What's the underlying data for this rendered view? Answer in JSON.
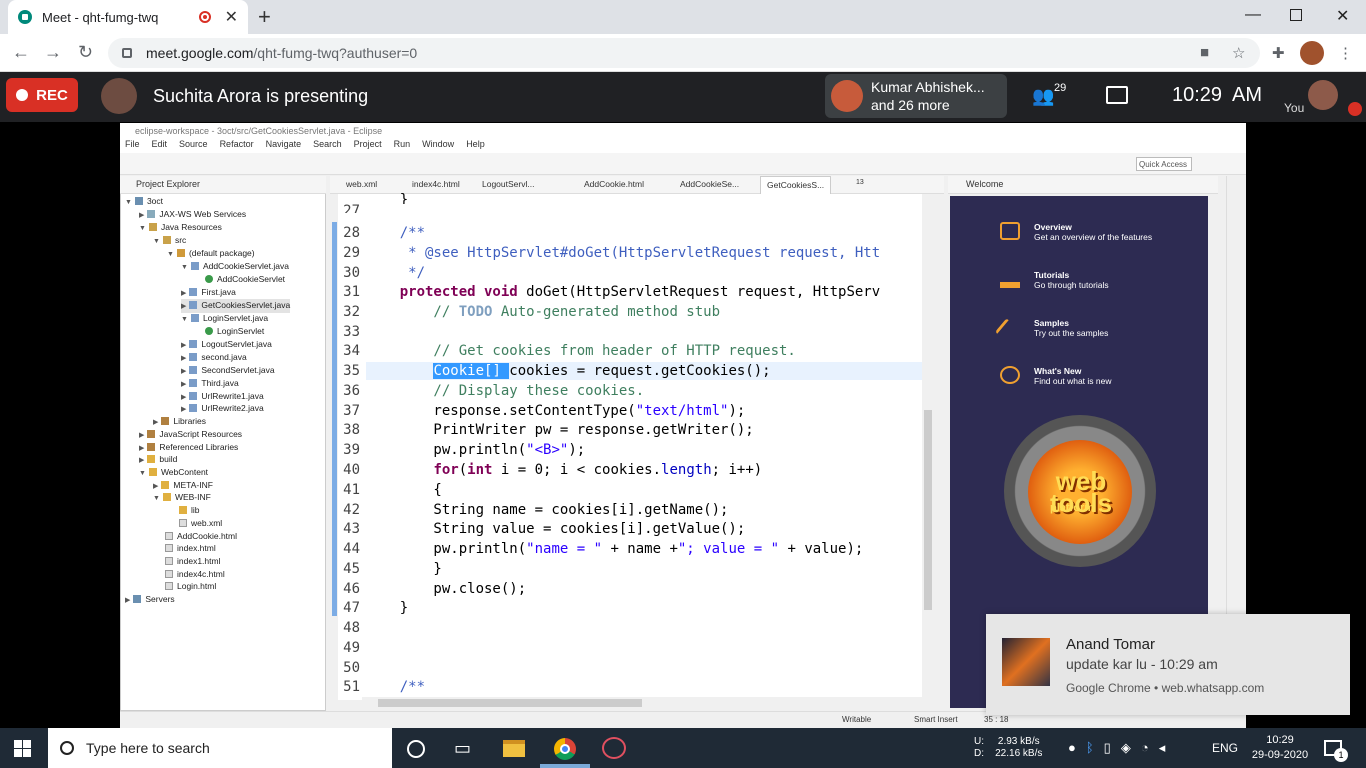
{
  "browser": {
    "tab_title": "Meet - qht-fumg-twq",
    "url_host": "meet.google.com",
    "url_path": "/qht-fumg-twq?authuser=0"
  },
  "meet": {
    "rec_label": "REC",
    "presenter_text": "Suchita Arora is presenting",
    "participant_name": "Kumar Abhishek...",
    "participant_more": "and 26 more",
    "people_count": "29",
    "time": "10:29  AM",
    "you_label": "You"
  },
  "eclipse": {
    "title": "eclipse-workspace - 3oct/src/GetCookiesServlet.java - Eclipse",
    "menu": [
      "File",
      "Edit",
      "Source",
      "Refactor",
      "Navigate",
      "Search",
      "Project",
      "Run",
      "Window",
      "Help"
    ],
    "quick_access": "Quick Access",
    "project_explorer_title": "Project Explorer",
    "tree": [
      "3oct",
      "JAX-WS Web Services",
      "Java Resources",
      "src",
      "(default package)",
      "AddCookieServlet.java",
      "AddCookieServlet",
      "First.java",
      "GetCookiesServlet.java",
      "LoginServlet.java",
      "LoginServlet",
      "LogoutServlet.java",
      "second.java",
      "SecondServlet.java",
      "Third.java",
      "UrlRewrite1.java",
      "UrlRewrite2.java",
      "Libraries",
      "JavaScript Resources",
      "Referenced Libraries",
      "build",
      "WebContent",
      "META-INF",
      "WEB-INF",
      "lib",
      "web.xml",
      "AddCookie.html",
      "index.html",
      "index1.html",
      "index4c.html",
      "Login.html",
      "Servers"
    ],
    "editor_tabs": [
      "web.xml",
      "index4c.html",
      "LogoutServl...",
      "AddCookie.html",
      "AddCookieSe...",
      "GetCookiesS...",
      "13"
    ],
    "line_numbers": [
      "27",
      "28",
      "29",
      "30",
      "31",
      "32",
      "33",
      "34",
      "35",
      "36",
      "37",
      "38",
      "39",
      "40",
      "41",
      "42",
      "43",
      "44",
      "45",
      "46",
      "47",
      "48",
      "49",
      "50",
      "51"
    ],
    "code": {
      "l27": "    }",
      "l28": "    /**",
      "l29_a": "     * @see ",
      "l29_b": "HttpServlet#doGet(HttpServletRequest request, Htt",
      "l30": "     */",
      "l31_kw": "    protected void ",
      "l31_rest": "doGet(HttpServletRequest request, HttpServ",
      "l32_a": "        // ",
      "l32_b": "TODO",
      "l32_c": " Auto-generated method stub",
      "l34": "        // Get cookies from header of HTTP request.",
      "l35_a": "Cookie[] ",
      "l35_b": "cookies = request.getCookies();",
      "l36": "        // Display these cookies.",
      "l37_a": "        response.setContentType(",
      "l37_b": "\"text/html\"",
      "l37_c": ");",
      "l38": "        PrintWriter pw = response.getWriter();",
      "l39_a": "        pw.println(",
      "l39_b": "\"<B>\"",
      "l39_c": ");",
      "l40_kw1": "for",
      "l40_b": "(",
      "l40_kw2": "int",
      "l40_c": " i = 0; i < cookies.",
      "l40_fd": "length",
      "l40_d": "; i++)",
      "l41": "        {",
      "l42": "        String name = cookies[i].getName();",
      "l43": "        String value = cookies[i].getValue();",
      "l44_a": "        pw.println(",
      "l44_b": "\"name = \"",
      "l44_c": " + name +",
      "l44_d": "\"; value = \"",
      "l44_e": " + value);",
      "l45": "        }",
      "l46": "        pw.close();",
      "l47": "    }",
      "l51": "    /**"
    },
    "welcome_title": "Welcome",
    "welcome_items": [
      {
        "title": "Overview",
        "desc": "Get an overview of the features"
      },
      {
        "title": "Tutorials",
        "desc": "Go through tutorials"
      },
      {
        "title": "Samples",
        "desc": "Try out the samples"
      },
      {
        "title": "What's New",
        "desc": "Find out what is new"
      }
    ],
    "logo_word": "web tools",
    "logo_sub": "platform",
    "status": {
      "writable": "Writable",
      "insert": "Smart Insert",
      "position": "35 : 18"
    }
  },
  "notification": {
    "sender": "Anand Tomar",
    "message": "update kar lu - 10:29 am",
    "source": "Google Chrome • web.whatsapp.com"
  },
  "taskbar": {
    "search_placeholder": "Type here to search",
    "upload": "2.93 kB/s",
    "download": "22.16 kB/s",
    "upload_label": "U:",
    "download_label": "D:",
    "lang": "ENG",
    "time": "10:29",
    "date": "29-09-2020",
    "notif_count": "1"
  }
}
